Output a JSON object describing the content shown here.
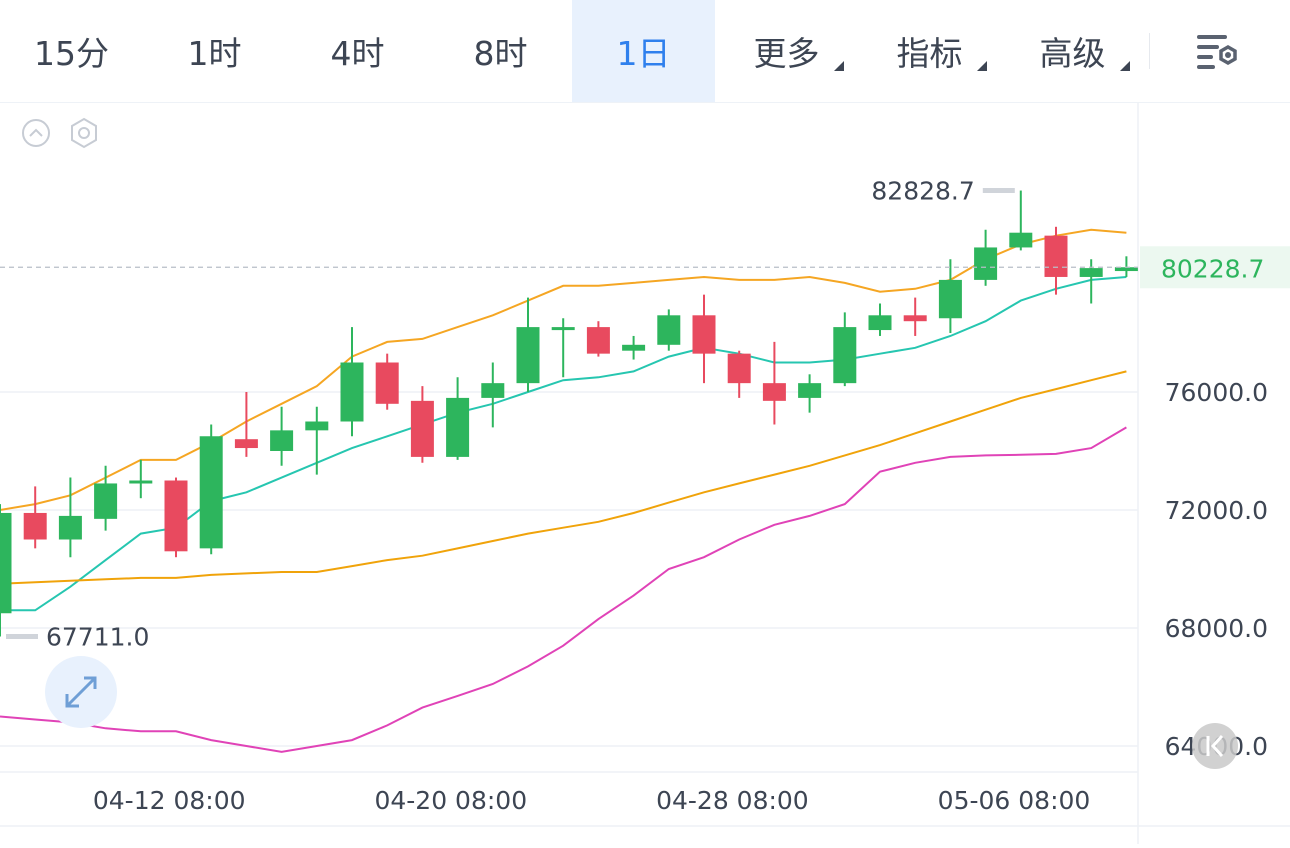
{
  "tabs": [
    {
      "label": "15分",
      "active": false,
      "dropdown": false
    },
    {
      "label": "1时",
      "active": false,
      "dropdown": false
    },
    {
      "label": "4时",
      "active": false,
      "dropdown": false
    },
    {
      "label": "8时",
      "active": false,
      "dropdown": false
    },
    {
      "label": "1日",
      "active": true,
      "dropdown": false
    },
    {
      "label": "更多",
      "active": false,
      "dropdown": true
    },
    {
      "label": "指标",
      "active": false,
      "dropdown": true
    },
    {
      "label": "高级",
      "active": false,
      "dropdown": true
    }
  ],
  "icons": {
    "settings": "chart-settings-icon",
    "collapse": "collapse-up-icon",
    "indicator": "hexagon-settings-icon",
    "fullscreen": "expand-arrows-icon",
    "scroll": "scroll-to-latest-icon"
  },
  "chart_data": {
    "type": "candlestick",
    "ylim": [
      63500,
      84500
    ],
    "y_ticks": [
      "76000.0",
      "72000.0",
      "68000.0",
      "64000.0"
    ],
    "y_tick_values": [
      76000,
      72000,
      68000,
      64000
    ],
    "x_tick_labels": [
      "04-12 08:00",
      "04-20 08:00",
      "04-28 08:00",
      "05-06 08:00"
    ],
    "x_tick_index": [
      6,
      14,
      22,
      30
    ],
    "current_price": 80228.7,
    "current_price_label": "80228.7",
    "max_label": "82828.7",
    "min_label": "67711.0",
    "max_price": 82828.7,
    "min_price": 67711.0,
    "colors": {
      "up": "#2db55d",
      "down": "#e84a5f",
      "ma1": "#f5a623",
      "ma2": "#26c6b0",
      "ma3": "#f0a30a",
      "ma4": "#e043b7",
      "accent": "#2f80ed"
    },
    "candles": [
      {
        "o": 68500,
        "h": 72200,
        "l": 67711,
        "c": 71900
      },
      {
        "o": 71900,
        "h": 72800,
        "l": 70700,
        "c": 71000
      },
      {
        "o": 71000,
        "h": 73100,
        "l": 70400,
        "c": 71800
      },
      {
        "o": 71700,
        "h": 73500,
        "l": 71300,
        "c": 72900
      },
      {
        "o": 72900,
        "h": 73700,
        "l": 72400,
        "c": 73000
      },
      {
        "o": 73000,
        "h": 73100,
        "l": 70400,
        "c": 70600
      },
      {
        "o": 70700,
        "h": 74900,
        "l": 70500,
        "c": 74500
      },
      {
        "o": 74400,
        "h": 76000,
        "l": 73800,
        "c": 74100
      },
      {
        "o": 74000,
        "h": 75500,
        "l": 73500,
        "c": 74700
      },
      {
        "o": 74700,
        "h": 75500,
        "l": 73200,
        "c": 75000
      },
      {
        "o": 75000,
        "h": 78200,
        "l": 74500,
        "c": 77000
      },
      {
        "o": 77000,
        "h": 77300,
        "l": 75400,
        "c": 75600
      },
      {
        "o": 75700,
        "h": 76200,
        "l": 73600,
        "c": 73800
      },
      {
        "o": 73800,
        "h": 76500,
        "l": 73700,
        "c": 75800
      },
      {
        "o": 75800,
        "h": 77000,
        "l": 74800,
        "c": 76300
      },
      {
        "o": 76300,
        "h": 79200,
        "l": 76000,
        "c": 78200
      },
      {
        "o": 78100,
        "h": 78500,
        "l": 76500,
        "c": 78200
      },
      {
        "o": 78200,
        "h": 78400,
        "l": 77200,
        "c": 77300
      },
      {
        "o": 77400,
        "h": 77900,
        "l": 77100,
        "c": 77600
      },
      {
        "o": 77600,
        "h": 78800,
        "l": 77400,
        "c": 78600
      },
      {
        "o": 78600,
        "h": 79300,
        "l": 76300,
        "c": 77300
      },
      {
        "o": 77300,
        "h": 77400,
        "l": 75800,
        "c": 76300
      },
      {
        "o": 76300,
        "h": 77700,
        "l": 74900,
        "c": 75700
      },
      {
        "o": 75800,
        "h": 76600,
        "l": 75300,
        "c": 76300
      },
      {
        "o": 76300,
        "h": 78700,
        "l": 76200,
        "c": 78200
      },
      {
        "o": 78100,
        "h": 79000,
        "l": 77900,
        "c": 78600
      },
      {
        "o": 78600,
        "h": 79200,
        "l": 77900,
        "c": 78400
      },
      {
        "o": 78500,
        "h": 80500,
        "l": 78000,
        "c": 79800
      },
      {
        "o": 79800,
        "h": 81500,
        "l": 79600,
        "c": 80900
      },
      {
        "o": 80900,
        "h": 82828.7,
        "l": 80800,
        "c": 81400
      },
      {
        "o": 81300,
        "h": 81600,
        "l": 79300,
        "c": 79900
      },
      {
        "o": 79900,
        "h": 80500,
        "l": 79000,
        "c": 80200
      },
      {
        "o": 80100,
        "h": 80600,
        "l": 79900,
        "c": 80228.7
      }
    ],
    "series": [
      {
        "key": "ma1",
        "values": [
          72000,
          72200,
          72500,
          73100,
          73700,
          73700,
          74300,
          75000,
          75600,
          76200,
          77200,
          77700,
          77800,
          78200,
          78600,
          79100,
          79600,
          79600,
          79700,
          79800,
          79900,
          79800,
          79800,
          79900,
          79700,
          79400,
          79500,
          79800,
          80500,
          81000,
          81300,
          81500,
          81400
        ]
      },
      {
        "key": "ma2",
        "values": [
          68600,
          68600,
          69400,
          70300,
          71200,
          71400,
          72300,
          72600,
          73100,
          73600,
          74100,
          74500,
          74900,
          75300,
          75600,
          76000,
          76400,
          76500,
          76700,
          77200,
          77500,
          77300,
          77000,
          77000,
          77100,
          77300,
          77500,
          77900,
          78400,
          79100,
          79500,
          79800,
          79900
        ]
      },
      {
        "key": "ma3",
        "values": [
          69500,
          69550,
          69600,
          69650,
          69700,
          69700,
          69800,
          69850,
          69900,
          69900,
          70100,
          70300,
          70450,
          70700,
          70950,
          71200,
          71400,
          71600,
          71900,
          72250,
          72600,
          72900,
          73200,
          73500,
          73850,
          74200,
          74600,
          75000,
          75400,
          75800,
          76100,
          76400,
          76700
        ]
      },
      {
        "key": "ma4",
        "values": [
          65000,
          64900,
          64800,
          64600,
          64500,
          64500,
          64200,
          64000,
          63800,
          64000,
          64200,
          64700,
          65300,
          65700,
          66100,
          66700,
          67400,
          68300,
          69100,
          70000,
          70400,
          71000,
          71500,
          71800,
          72200,
          73300,
          73600,
          73800,
          73850,
          73870,
          73900,
          74100,
          74800
        ]
      }
    ]
  }
}
